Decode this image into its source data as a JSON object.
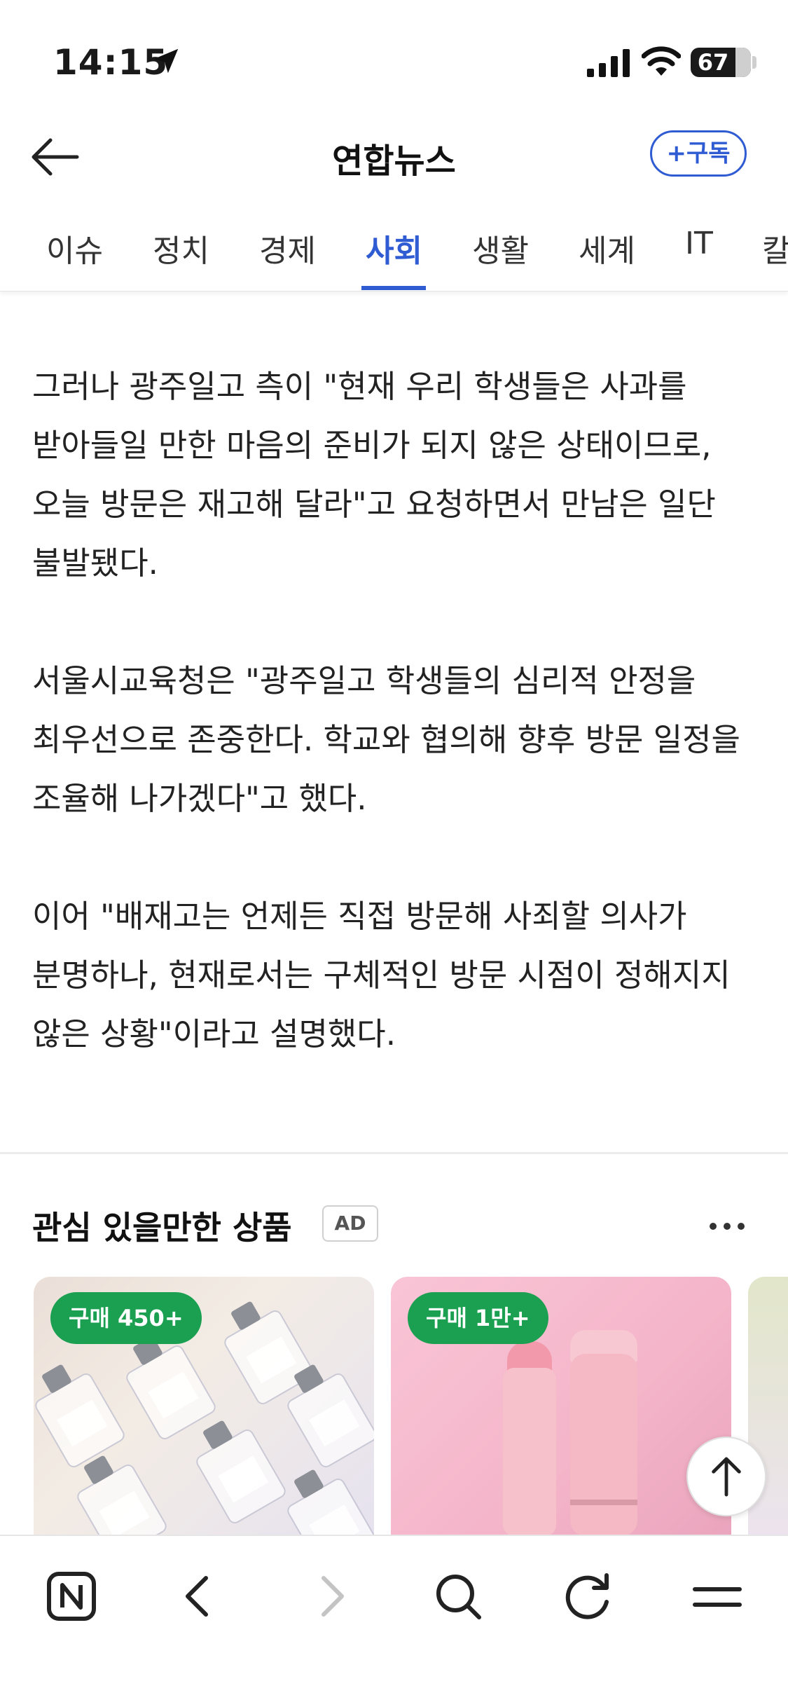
{
  "status_bar": {
    "time": "14:15",
    "battery": "67"
  },
  "header": {
    "title": "연합뉴스",
    "subscribe_label": "+구독"
  },
  "tabs": [
    {
      "label": "이슈"
    },
    {
      "label": "정치"
    },
    {
      "label": "경제"
    },
    {
      "label": "사회",
      "active": true
    },
    {
      "label": "생활"
    },
    {
      "label": "세계"
    },
    {
      "label": "IT"
    },
    {
      "label": "칼"
    }
  ],
  "article": {
    "paragraphs": [
      "그러나 광주일고 측이 \"현재 우리 학생들은 사과를 받아들일 만한 마음의 준비가 되지 않은 상태이므로, 오늘 방문은 재고해 달라\"고 요청하면서 만남은 일단 불발됐다.",
      "서울시교육청은 \"광주일고 학생들의 심리적 안정을 최우선으로 존중한다. 학교와 협의해 향후 방문 일정을 조율해 나가겠다\"고 했다.",
      "이어 \"배재고는 언제든 직접 방문해 사죄할 의사가 분명하나, 현재로서는 구체적인 방문 시점이 정해지지 않은 상황\"이라고 설명했다."
    ]
  },
  "recommendations": {
    "title": "관심 있을만한 상품",
    "ad_label": "AD",
    "cards": [
      {
        "badge": "구매 450+"
      },
      {
        "badge": "구매 1만+"
      }
    ]
  },
  "colors": {
    "accent": "#2f5bd3",
    "badge_green": "#1aa050"
  },
  "icons": [
    "location-arrow-icon",
    "signal-icon",
    "wifi-icon",
    "back-arrow-icon",
    "more-icon",
    "arrow-up-icon",
    "naver-n-icon",
    "chevron-left-icon",
    "chevron-right-icon",
    "search-icon",
    "refresh-icon",
    "menu-icon"
  ]
}
